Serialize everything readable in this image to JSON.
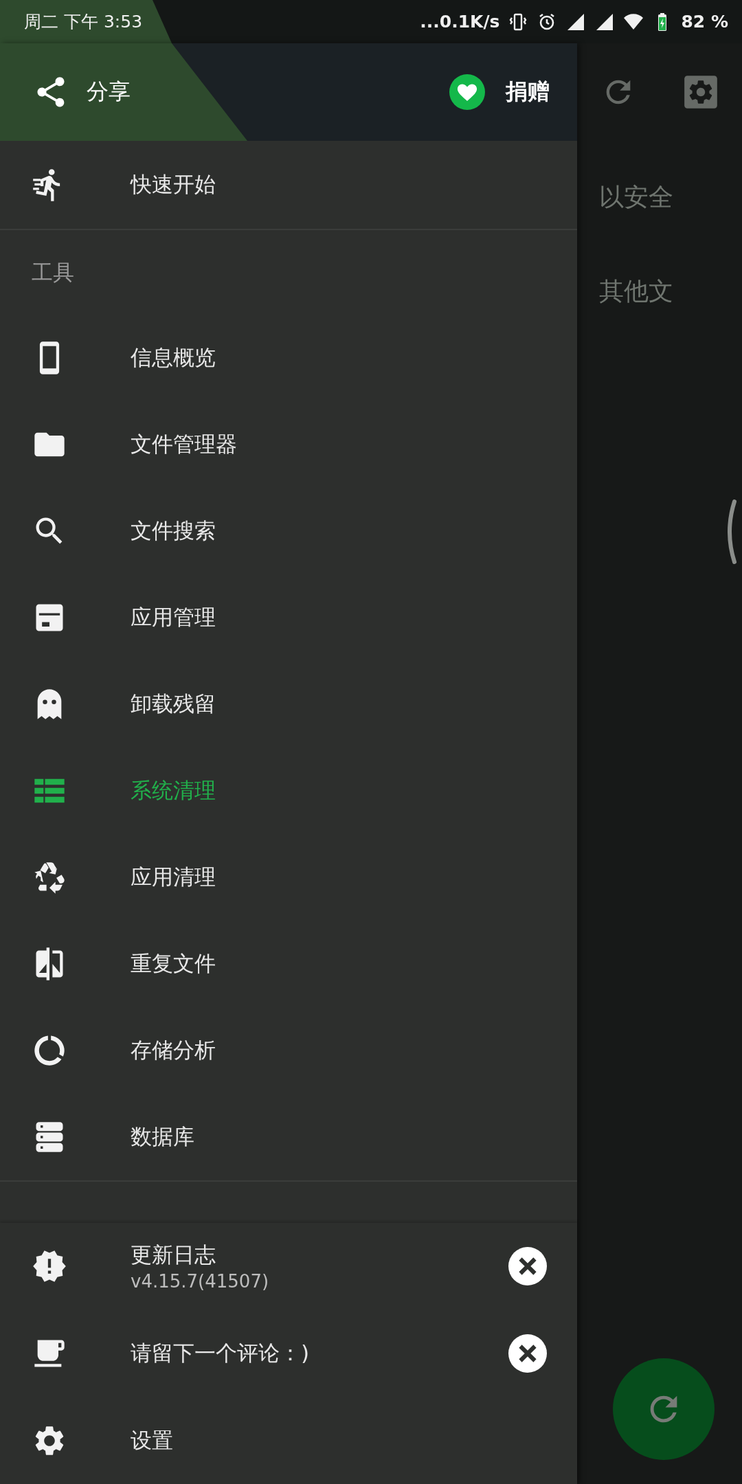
{
  "status_bar": {
    "time": "周二 下午 3:53",
    "network_speed": "...0.1K/s",
    "battery": "82 %"
  },
  "drawer": {
    "header": {
      "share": "分享",
      "donate": "捐赠"
    },
    "quick_start": {
      "label": "快速开始"
    },
    "tools": {
      "title": "工具",
      "items": [
        {
          "label": "信息概览",
          "selected": false
        },
        {
          "label": "文件管理器",
          "selected": false
        },
        {
          "label": "文件搜索",
          "selected": false
        },
        {
          "label": "应用管理",
          "selected": false
        },
        {
          "label": "卸载残留",
          "selected": false
        },
        {
          "label": "系统清理",
          "selected": true
        },
        {
          "label": "应用清理",
          "selected": false
        },
        {
          "label": "重复文件",
          "selected": false
        },
        {
          "label": "存储分析",
          "selected": false
        },
        {
          "label": "数据库",
          "selected": false
        }
      ]
    },
    "footer": [
      {
        "label": "更新日志",
        "subtitle": "v4.15.7(41507)",
        "dismissible": true
      },
      {
        "label": "请留下一个评论：)",
        "dismissible": true
      },
      {
        "label": "设置",
        "dismissible": false
      }
    ]
  },
  "main": {
    "text_lines": [
      "以安全",
      "其他文"
    ]
  }
}
